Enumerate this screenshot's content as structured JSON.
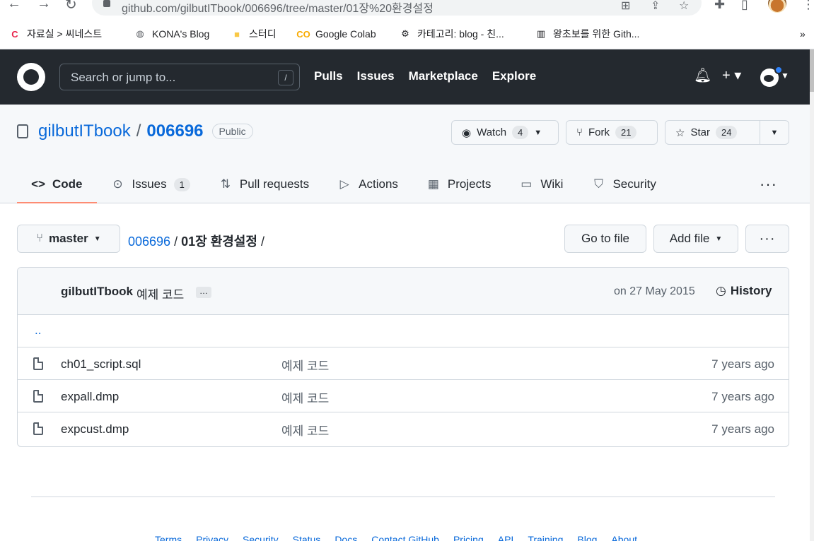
{
  "browser": {
    "url": "github.com/gilbutITbook/006696/tree/master/01장%20환경설정",
    "bookmarks": [
      {
        "label": "자료실 > 씨네스트",
        "icon": "c-icon",
        "color": "#e8224a"
      },
      {
        "label": "KONA's Blog",
        "icon": "globe-icon",
        "color": "#5f6368"
      },
      {
        "label": "스터디",
        "icon": "folder-icon",
        "color": "#f9c846"
      },
      {
        "label": "Google Colab",
        "icon": "colab-icon",
        "color": "#f9ab00"
      },
      {
        "label": "카테고리: blog - 친...",
        "icon": "gear-icon",
        "color": "#202124"
      },
      {
        "label": "왕초보를 위한 Gith...",
        "icon": "piano-icon",
        "color": "#202124"
      }
    ],
    "overflow": "»"
  },
  "header": {
    "search_placeholder": "Search or jump to...",
    "search_shortcut": "/",
    "nav": [
      "Pulls",
      "Issues",
      "Marketplace",
      "Explore"
    ]
  },
  "repo": {
    "owner": "gilbutITbook",
    "name": "006696",
    "visibility": "Public",
    "watch": {
      "label": "Watch",
      "count": "4"
    },
    "fork": {
      "label": "Fork",
      "count": "21"
    },
    "star": {
      "label": "Star",
      "count": "24"
    }
  },
  "tabs": [
    {
      "label": "Code",
      "icon": "code-icon",
      "active": true
    },
    {
      "label": "Issues",
      "icon": "issue-icon",
      "count": "1"
    },
    {
      "label": "Pull requests",
      "icon": "pr-icon"
    },
    {
      "label": "Actions",
      "icon": "play-icon"
    },
    {
      "label": "Projects",
      "icon": "table-icon"
    },
    {
      "label": "Wiki",
      "icon": "book-icon"
    },
    {
      "label": "Security",
      "icon": "shield-icon"
    }
  ],
  "filenav": {
    "branch": "master",
    "repo_link": "006696",
    "directory": "01장 환경설정",
    "go_to_file": "Go to file",
    "add_file": "Add file"
  },
  "commit": {
    "author": "gilbutITbook",
    "message": "예제 코드",
    "ellipsis": "…",
    "date": "on 27 May 2015",
    "history_label": "History"
  },
  "files": [
    {
      "name": "ch01_script.sql",
      "message": "예제 코드",
      "age": "7 years ago"
    },
    {
      "name": "expall.dmp",
      "message": "예제 코드",
      "age": "7 years ago"
    },
    {
      "name": "expcust.dmp",
      "message": "예제 코드",
      "age": "7 years ago"
    }
  ],
  "up_dir": "..",
  "footer": [
    "Terms",
    "Privacy",
    "Security",
    "Status",
    "Docs",
    "Contact GitHub",
    "Pricing",
    "API",
    "Training",
    "Blog",
    "About"
  ]
}
